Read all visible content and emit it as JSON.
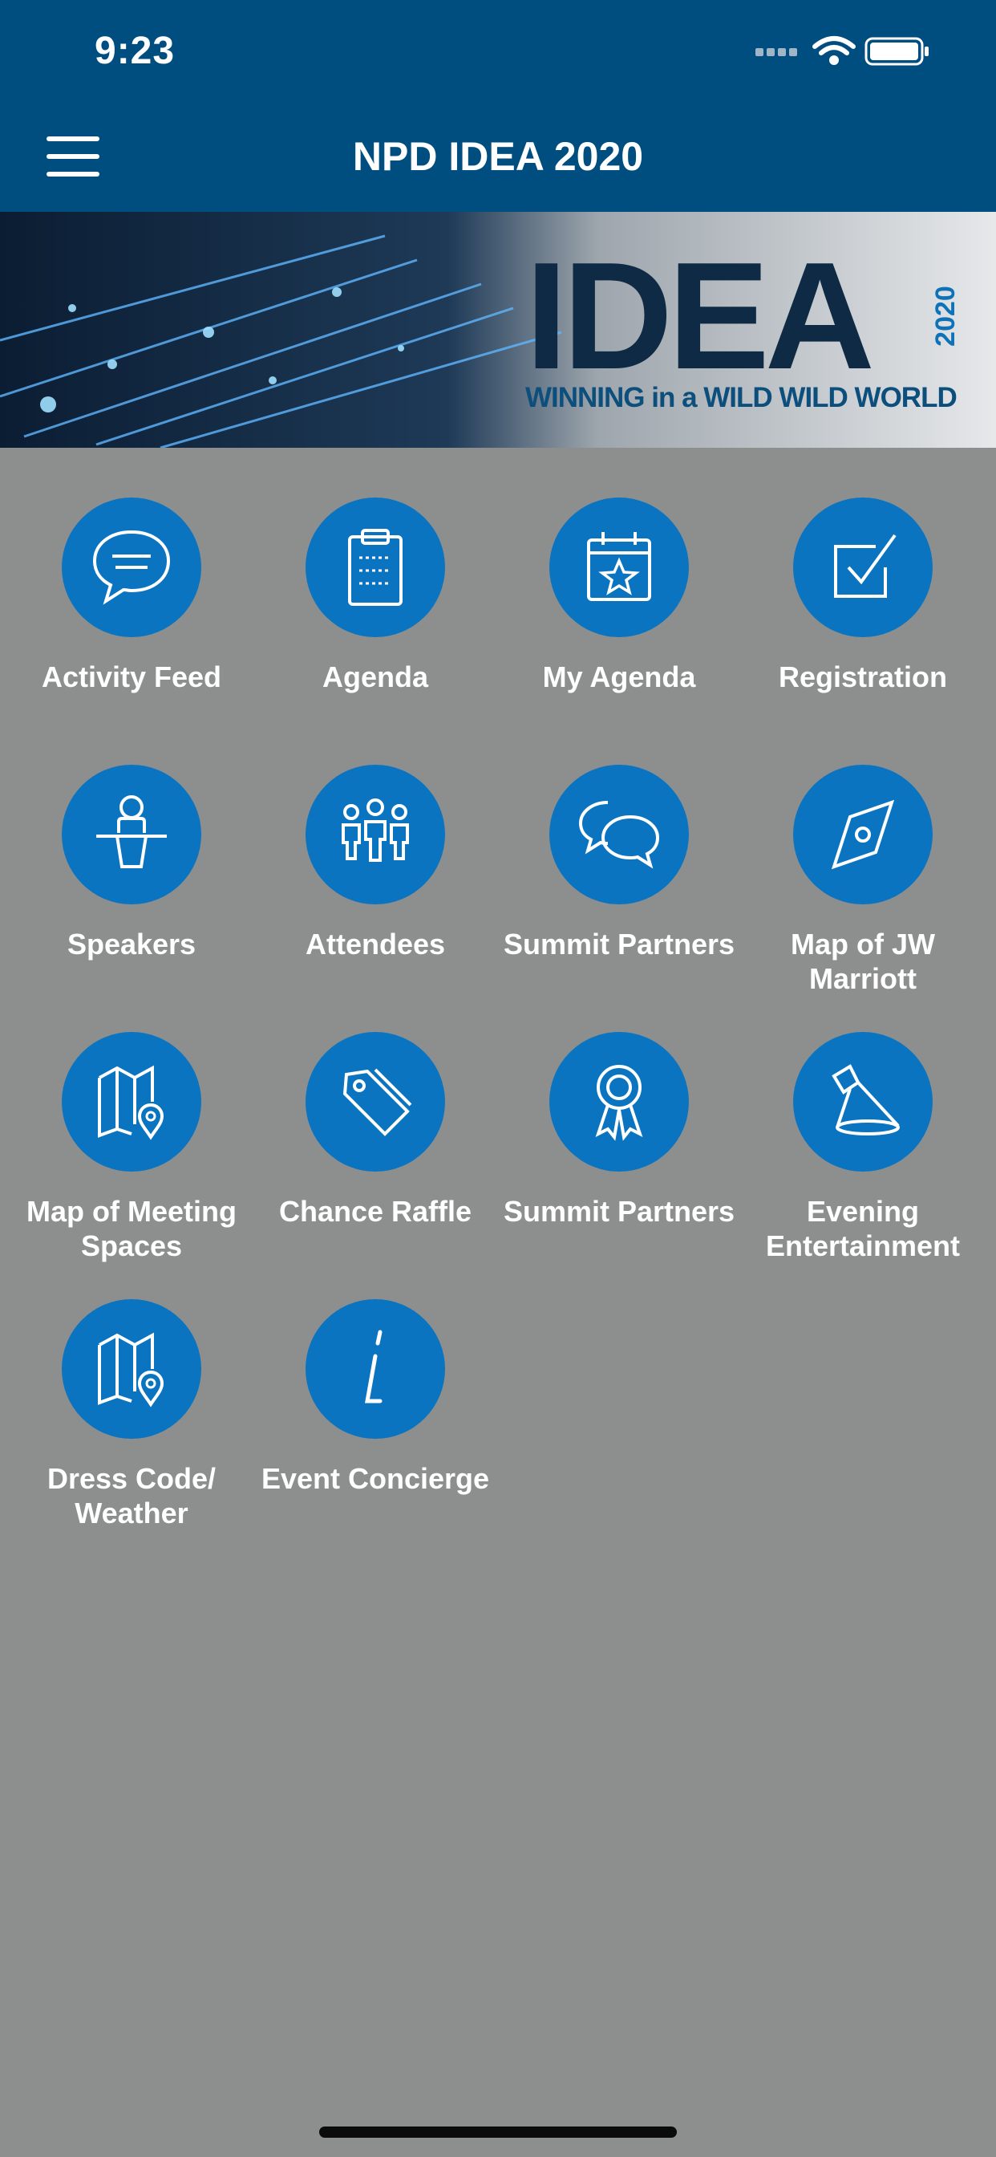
{
  "status_bar": {
    "time": "9:23"
  },
  "header": {
    "title": "NPD IDEA 2020",
    "menu_icon": "hamburger-menu-icon"
  },
  "banner": {
    "logo_text": "IDEA",
    "year": "2020",
    "tagline": "WINNING in a WILD WILD WORLD"
  },
  "tiles": [
    {
      "label": "Activity Feed",
      "icon": "speech-bubble-icon"
    },
    {
      "label": "Agenda",
      "icon": "clipboard-icon"
    },
    {
      "label": "My Agenda",
      "icon": "calendar-star-icon"
    },
    {
      "label": "Registration",
      "icon": "checkbox-icon"
    },
    {
      "label": "Speakers",
      "icon": "podium-speaker-icon"
    },
    {
      "label": "Attendees",
      "icon": "people-group-icon"
    },
    {
      "label": "Summit Partners",
      "icon": "chat-bubbles-icon"
    },
    {
      "label": "Map of JW Marriott",
      "icon": "compass-icon"
    },
    {
      "label": "Map of Meeting Spaces",
      "icon": "map-pin-icon"
    },
    {
      "label": "Chance Raffle",
      "icon": "tag-icon"
    },
    {
      "label": "Summit Partners",
      "icon": "award-ribbon-icon"
    },
    {
      "label": "Evening Entertainment",
      "icon": "spotlight-icon"
    },
    {
      "label": "Dress Code/ Weather",
      "icon": "map-pin-icon"
    },
    {
      "label": "Event Concierge",
      "icon": "info-icon"
    }
  ],
  "colors": {
    "header": "#004e7f",
    "background": "#8d8f8f",
    "tile_circle": "#0a74c1"
  }
}
